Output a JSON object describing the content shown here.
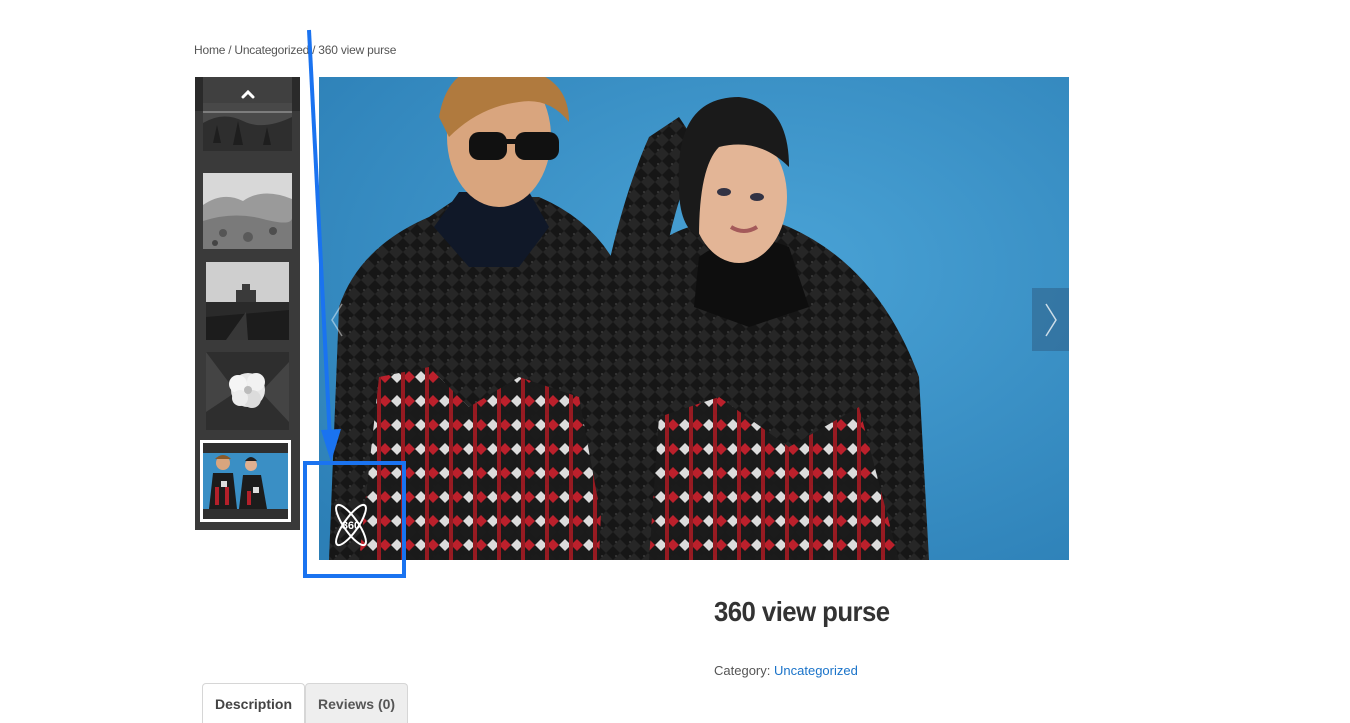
{
  "breadcrumb": {
    "items": [
      "Home",
      "Uncategorized",
      "360 view purse"
    ],
    "separator": "/"
  },
  "gallery": {
    "up_icon": "chevron-up-icon",
    "thumbnails": [
      {
        "subject": "misty-forest"
      },
      {
        "subject": "desert-hills"
      },
      {
        "subject": "monument-valley"
      },
      {
        "subject": "white-flower"
      },
      {
        "subject": "fashion-couple",
        "active": true
      }
    ],
    "main_image": {
      "subject": "two models in knit sweaters"
    },
    "prev_icon": "chevron-left-icon",
    "next_icon": "chevron-right-icon",
    "view_360_icon": "view-360-icon",
    "view_360_label": "360"
  },
  "annotation": {
    "color": "#1a73f0"
  },
  "product": {
    "title": "360 view purse",
    "category_label": "Category:",
    "category_value": "Uncategorized"
  },
  "tabs": [
    {
      "label": "Description",
      "active": true
    },
    {
      "label": "Reviews (0)",
      "active": false
    }
  ],
  "colors": {
    "link": "#1a73c9",
    "background": "#ffffff",
    "photo_bg": "#3a8fc5"
  }
}
